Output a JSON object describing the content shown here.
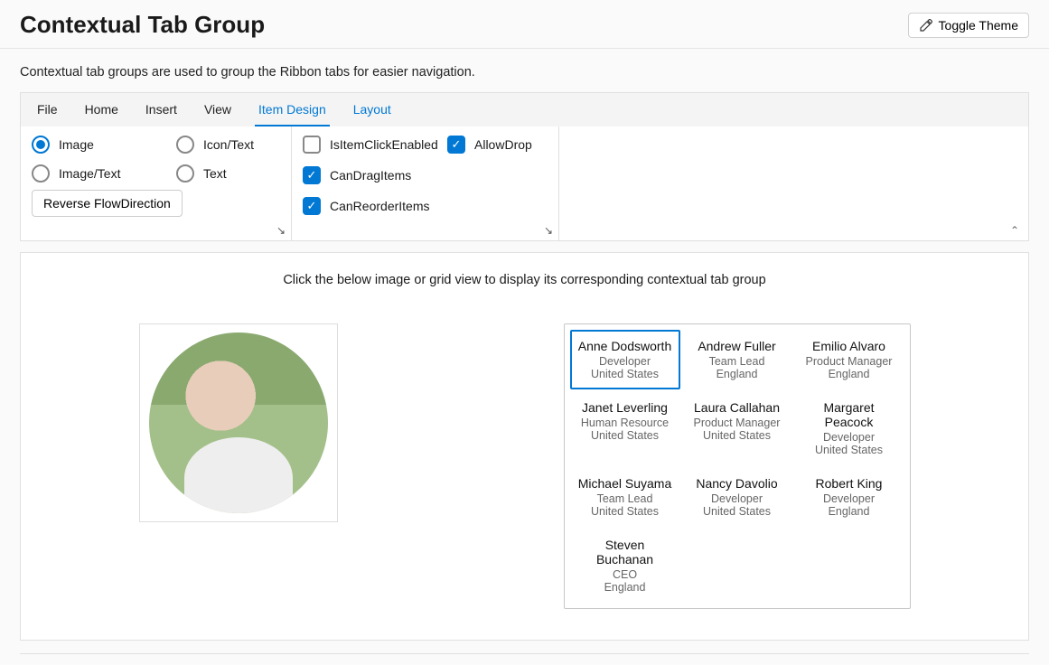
{
  "header": {
    "title": "Contextual Tab Group",
    "toggle_label": "Toggle Theme"
  },
  "description": "Contextual tab groups are used to group the Ribbon tabs for easier navigation.",
  "tabs": {
    "file": "File",
    "home": "Home",
    "insert": "Insert",
    "view": "View",
    "item_design": "Item Design",
    "layout": "Layout"
  },
  "group1": {
    "radios": {
      "image": "Image",
      "icon_text": "Icon/Text",
      "image_text": "Image/Text",
      "text": "Text"
    },
    "reverse_button": "Reverse FlowDirection"
  },
  "group2": {
    "checks": {
      "item_click": "IsItemClickEnabled",
      "allow_drop": "AllowDrop",
      "can_drag": "CanDragItems",
      "can_reorder": "CanReorderItems"
    }
  },
  "content": {
    "hint": "Click the below image or grid view to display its corresponding contextual tab group"
  },
  "people": [
    {
      "name": "Anne Dodsworth",
      "role": "Developer",
      "loc": "United States",
      "selected": true
    },
    {
      "name": "Andrew Fuller",
      "role": "Team Lead",
      "loc": "England"
    },
    {
      "name": "Emilio Alvaro",
      "role": "Product Manager",
      "loc": "England"
    },
    {
      "name": "Janet Leverling",
      "role": "Human Resource",
      "loc": "United States"
    },
    {
      "name": "Laura Callahan",
      "role": "Product Manager",
      "loc": "United States"
    },
    {
      "name": "Margaret Peacock",
      "role": "Developer",
      "loc": "United States"
    },
    {
      "name": "Michael Suyama",
      "role": "Team Lead",
      "loc": "United States"
    },
    {
      "name": "Nancy Davolio",
      "role": "Developer",
      "loc": "United States"
    },
    {
      "name": "Robert King",
      "role": "Developer",
      "loc": "England"
    },
    {
      "name": "Steven Buchanan",
      "role": "CEO",
      "loc": "England"
    }
  ]
}
